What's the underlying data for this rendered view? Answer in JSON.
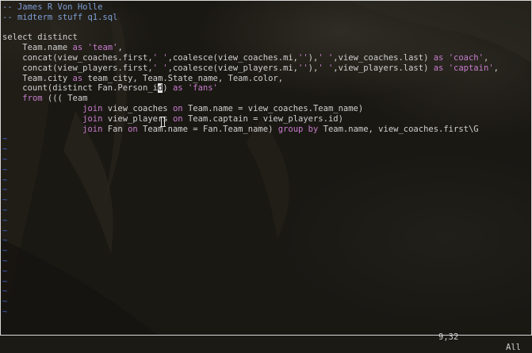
{
  "editor": {
    "lines": [
      {
        "segments": [
          {
            "t": "-- James R Von Holle",
            "c": "comment"
          }
        ]
      },
      {
        "segments": [
          {
            "t": "-- midterm stuff q1.sql",
            "c": "comment"
          }
        ]
      },
      {
        "segments": [
          {
            "t": "",
            "c": "plain"
          }
        ]
      },
      {
        "segments": [
          {
            "t": "select distinct",
            "c": "plain"
          }
        ]
      },
      {
        "segments": [
          {
            "t": "    Team.name ",
            "c": "plain"
          },
          {
            "t": "as",
            "c": "keyword"
          },
          {
            "t": " ",
            "c": "plain"
          },
          {
            "t": "'team'",
            "c": "string"
          },
          {
            "t": ",",
            "c": "plain"
          }
        ]
      },
      {
        "segments": [
          {
            "t": "    concat(view_coaches.first,",
            "c": "plain"
          },
          {
            "t": "' '",
            "c": "string"
          },
          {
            "t": ",coalesce(view_coaches.mi,",
            "c": "plain"
          },
          {
            "t": "''",
            "c": "string"
          },
          {
            "t": "),",
            "c": "plain"
          },
          {
            "t": "' '",
            "c": "string"
          },
          {
            "t": ",view_coaches.last) ",
            "c": "plain"
          },
          {
            "t": "as",
            "c": "keyword"
          },
          {
            "t": " ",
            "c": "plain"
          },
          {
            "t": "'coach'",
            "c": "string"
          },
          {
            "t": ",",
            "c": "plain"
          }
        ]
      },
      {
        "segments": [
          {
            "t": "    concat(view_players.first,",
            "c": "plain"
          },
          {
            "t": "' '",
            "c": "string"
          },
          {
            "t": ",coalesce(view_players.mi,",
            "c": "plain"
          },
          {
            "t": "''",
            "c": "string"
          },
          {
            "t": "),",
            "c": "plain"
          },
          {
            "t": "' '",
            "c": "string"
          },
          {
            "t": ",view_players.last) ",
            "c": "plain"
          },
          {
            "t": "as",
            "c": "keyword"
          },
          {
            "t": " ",
            "c": "plain"
          },
          {
            "t": "'captain'",
            "c": "string"
          },
          {
            "t": ",",
            "c": "plain"
          }
        ]
      },
      {
        "segments": [
          {
            "t": "    Team.city ",
            "c": "plain"
          },
          {
            "t": "as",
            "c": "keyword"
          },
          {
            "t": " team_city, Team.State_name, Team.color,",
            "c": "plain"
          }
        ]
      },
      {
        "segments": [
          {
            "t": "    count(distinct Fan.Person_i",
            "c": "plain"
          },
          {
            "t": "d",
            "c": "cursor"
          },
          {
            "t": ") ",
            "c": "plain"
          },
          {
            "t": "as",
            "c": "keyword"
          },
          {
            "t": " ",
            "c": "plain"
          },
          {
            "t": "'fans'",
            "c": "string"
          }
        ]
      },
      {
        "segments": [
          {
            "t": "    ",
            "c": "plain"
          },
          {
            "t": "from",
            "c": "keyword"
          },
          {
            "t": " ((( Team",
            "c": "plain"
          }
        ]
      },
      {
        "segments": [
          {
            "t": "                ",
            "c": "plain"
          },
          {
            "t": "join",
            "c": "keyword"
          },
          {
            "t": " view_coaches ",
            "c": "plain"
          },
          {
            "t": "on",
            "c": "keyword"
          },
          {
            "t": " Team.name = view_coaches.Team_name)",
            "c": "plain"
          }
        ]
      },
      {
        "segments": [
          {
            "t": "                ",
            "c": "plain"
          },
          {
            "t": "join",
            "c": "keyword"
          },
          {
            "t": " view_players ",
            "c": "plain"
          },
          {
            "t": "on",
            "c": "keyword"
          },
          {
            "t": " Team.captain = view_players.id)",
            "c": "plain"
          }
        ]
      },
      {
        "segments": [
          {
            "t": "                ",
            "c": "plain"
          },
          {
            "t": "join",
            "c": "keyword"
          },
          {
            "t": " Fan ",
            "c": "plain"
          },
          {
            "t": "on",
            "c": "keyword"
          },
          {
            "t": " Team.name = Fan.Team_name) ",
            "c": "plain"
          },
          {
            "t": "group by",
            "c": "keyword"
          },
          {
            "t": " Team.name, view_coaches.first\\G",
            "c": "plain"
          }
        ]
      }
    ],
    "tilde_marker": "~",
    "tilde_count": 18
  },
  "status": {
    "position": "9,32",
    "scroll": "All"
  },
  "colors": {
    "comment": "#7e9fd6",
    "keyword": "#c77dcd",
    "string": "#c77dcd",
    "tilde": "#3d5fc4",
    "text": "#d0d0d0",
    "background": "#1c1a15"
  }
}
